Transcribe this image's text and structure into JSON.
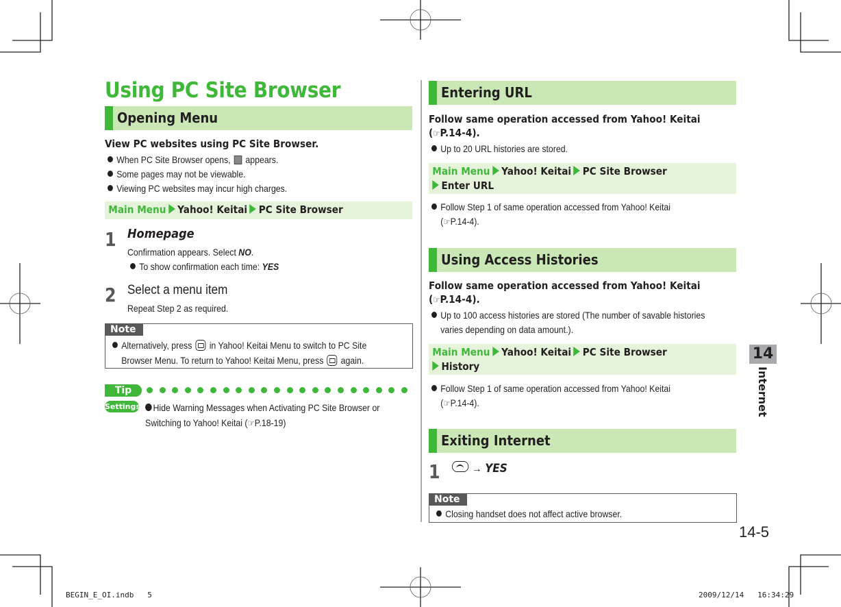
{
  "page": {
    "title": "Using PC Site Browser",
    "chapter_number": "14",
    "chapter_label": "Internet",
    "page_number": "14-5",
    "slug_left": "BEGIN_E_OI.indb   5",
    "slug_right": "2009/12/14   16:34:29"
  },
  "colors": {
    "accent_green": "#3fb83a",
    "header_bg": "#c9e8b5",
    "nav_bg": "#e4f3d9",
    "note_gray": "#58595b"
  },
  "opening_menu": {
    "heading": "Opening Menu",
    "lead": "View PC websites using PC Site Browser.",
    "bullets": [
      {
        "before": "When PC Site Browser opens, ",
        "icon": "pc-site-browser-icon",
        "after": " appears."
      },
      {
        "text": "Some pages may not be viewable."
      },
      {
        "text": "Viewing PC websites may incur high charges."
      }
    ],
    "nav": {
      "start": "Main Menu",
      "items": [
        "Yahoo! Keitai",
        "PC Site Browser"
      ]
    },
    "steps": [
      {
        "number": "1",
        "title": "Homepage",
        "text_before": "Confirmation appears. Select ",
        "text_bold": "NO",
        "text_after": ".",
        "sub_before": "To show confirmation each time: ",
        "sub_bold": "YES"
      },
      {
        "number": "2",
        "title": "Select a menu item",
        "text": "Repeat Step 2 as required."
      }
    ],
    "note": {
      "label": "Note",
      "line1_before": "Alternatively, press ",
      "line1_after": " in Yahoo! Keitai Menu to switch to PC Site",
      "line2_before": "Browser Menu. To return to Yahoo! Keitai Menu, press ",
      "line2_after": " again.",
      "key_icon": "mail-key-icon"
    },
    "tip": {
      "label": "Tip",
      "settings_label": "Settings",
      "line1": "Hide Warning Messages when Activating PC Site Browser or",
      "line2_before": "Switching to Yahoo! Keitai (",
      "line2_ref": "P.18-19",
      "line2_after": ")"
    }
  },
  "entering_url": {
    "heading": "Entering URL",
    "lead_line1": "Follow same operation accessed from Yahoo! Keitai",
    "lead_line2_before": "(",
    "lead_ref": "P.14-4",
    "lead_line2_after": ").",
    "bullet": "Up to 20 URL histories are stored.",
    "nav": {
      "start": "Main Menu",
      "items": [
        "Yahoo! Keitai",
        "PC Site Browser"
      ],
      "line2": "Enter URL"
    },
    "after_bullet_line1": "Follow Step 1 of same operation accessed from Yahoo! Keitai",
    "after_bullet_line2_before": "(",
    "after_ref": "P.14-4",
    "after_bullet_line2_after": ")."
  },
  "access_histories": {
    "heading": "Using Access Histories",
    "lead_line1": "Follow same operation accessed from Yahoo! Keitai",
    "lead_line2_before": "(",
    "lead_ref": "P.14-4",
    "lead_line2_after": ").",
    "bullet_line1": "Up to 100 access histories are stored (The number of savable histories",
    "bullet_line2": "varies depending on data amount.).",
    "nav": {
      "start": "Main Menu",
      "items": [
        "Yahoo! Keitai",
        "PC Site Browser"
      ],
      "line2": "History"
    },
    "after_bullet_line1": "Follow Step 1 of same operation accessed from Yahoo! Keitai",
    "after_bullet_line2_before": "(",
    "after_ref": "P.14-4",
    "after_bullet_line2_after": ")."
  },
  "exiting": {
    "heading": "Exiting Internet",
    "step_number": "1",
    "key_icon": "end-call-key-icon",
    "arrow": "→",
    "result": "YES",
    "note": {
      "label": "Note",
      "text": "Closing handset does not affect active browser."
    }
  },
  "ref_icon": "☞"
}
